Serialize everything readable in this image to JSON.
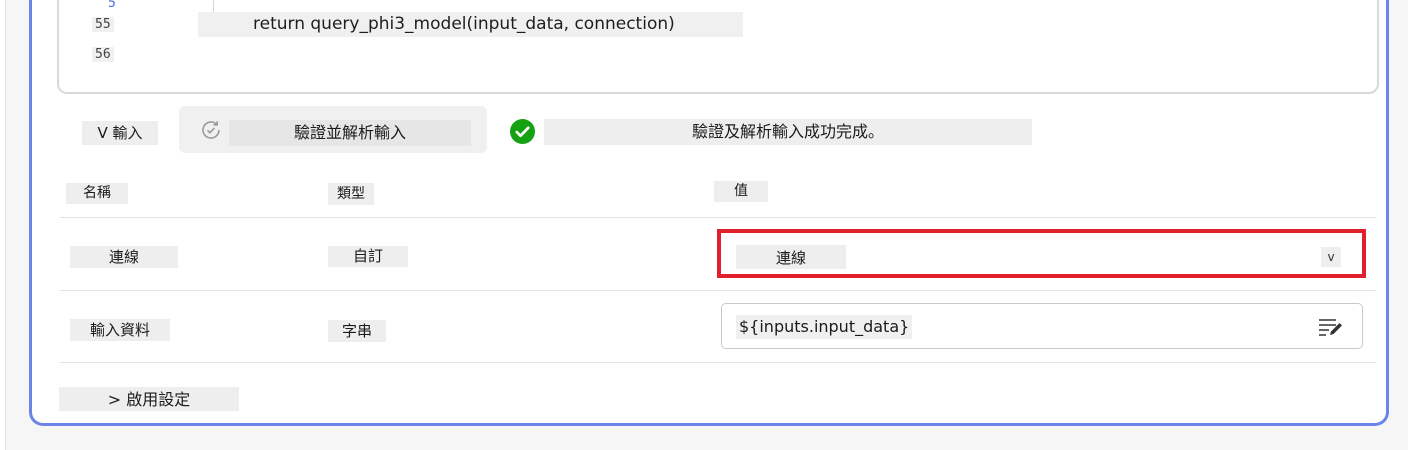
{
  "editor": {
    "line_numbers": [
      "55",
      "56"
    ],
    "partial_line_number": "5",
    "code_line": "return query_phi3_model(input_data, connection)"
  },
  "inputs_section": {
    "toggle_label": "V 輸入",
    "validate_button_label": "驗證並解析輸入",
    "success_message": "驗證及解析輸入成功完成。"
  },
  "table": {
    "headers": {
      "name": "名稱",
      "type": "類型",
      "value": "值"
    },
    "rows": [
      {
        "name": "連線",
        "type": "自訂",
        "value": "連線",
        "control": "dropdown"
      },
      {
        "name": "輸入資料",
        "type": "字串",
        "value": "${inputs.input_data}",
        "control": "text"
      }
    ]
  },
  "activation": {
    "label": "> 啟用設定"
  },
  "dropdown_chevron": "v",
  "colors": {
    "accent_border": "#6c83e8",
    "highlight_box": "#e0202c",
    "success": "#16a112"
  },
  "icons": [
    "refresh-check-icon",
    "success-check-icon",
    "chevron-down-icon",
    "edit-text-icon"
  ]
}
